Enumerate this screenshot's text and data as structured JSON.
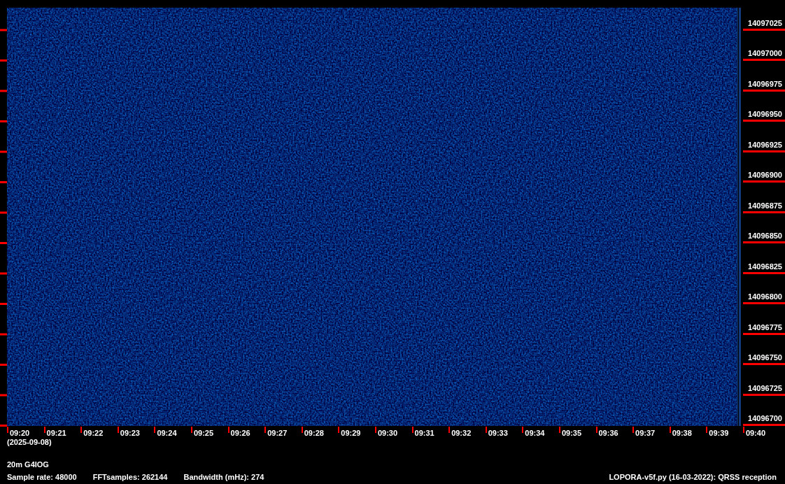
{
  "spectrogram": {
    "frequency_labels": [
      "14097025",
      "14097000",
      "14096975",
      "14096950",
      "14096925",
      "14096900",
      "14096875",
      "14096850",
      "14096825",
      "14096800",
      "14096775",
      "14096750",
      "14096725",
      "14096700"
    ],
    "time_labels": [
      "09:20",
      "09:21",
      "09:22",
      "09:23",
      "09:24",
      "09:25",
      "09:26",
      "09:27",
      "09:28",
      "09:29",
      "09:30",
      "09:31",
      "09:32",
      "09:33",
      "09:34",
      "09:35",
      "09:36",
      "09:37",
      "09:38",
      "09:39",
      "09:40"
    ],
    "date": "(2025-09-08)"
  },
  "station": "20m G4IOG",
  "settings": [
    "Sample rate: 48000",
    "FFTsamples: 262144",
    "Bandwidth (mHz): 274"
  ],
  "program": "LOPORA-v5f.py (16-03-2022): QRSS reception"
}
